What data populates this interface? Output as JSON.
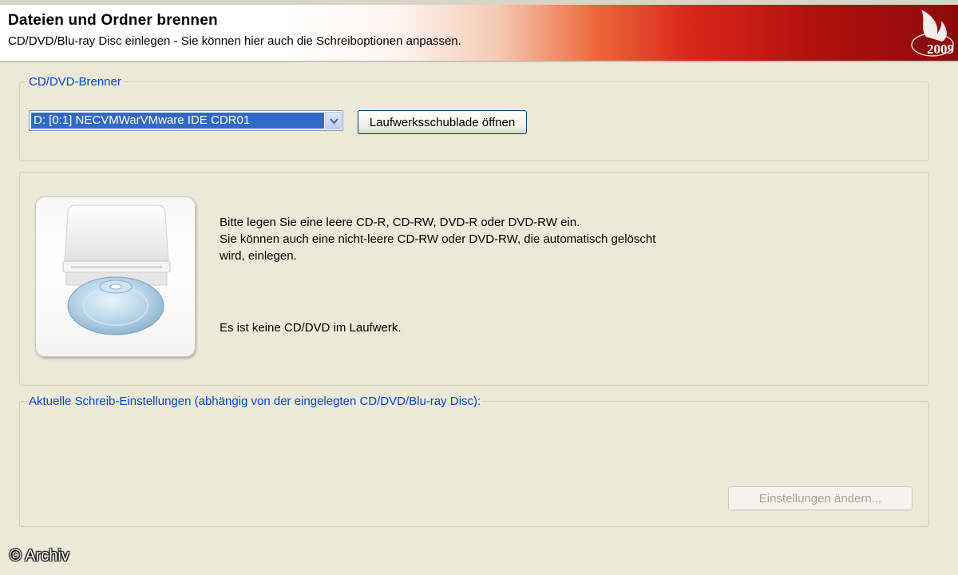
{
  "header": {
    "title": "Dateien und Ordner brennen",
    "subtitle": "CD/DVD/Blu-ray Disc einlegen - Sie können hier auch die Schreiboptionen anpassen.",
    "logo_year": "2009",
    "logo_icon": "flame-icon"
  },
  "burner_group": {
    "legend": "CD/DVD-Brenner",
    "drive_select_value": "D: [0:1] NECVMWarVMware IDE CDR01",
    "eject_button": "Laufwerksschublade öffnen"
  },
  "disc_group": {
    "drive_icon": "cd-drive-icon",
    "instruction_lines": [
      "Bitte legen Sie eine leere CD-R, CD-RW, DVD-R oder DVD-RW ein.",
      "Sie können auch eine nicht-leere CD-RW oder DVD-RW, die automatisch gelöscht",
      "wird, einlegen."
    ],
    "status": "Es ist keine CD/DVD im Laufwerk."
  },
  "settings_group": {
    "legend": "Aktuelle Schreib-Einstellungen (abhängig von der eingelegten CD/DVD/Blu-ray Disc):",
    "change_button": "Einstellungen ändern..."
  },
  "watermark": "© Archiv",
  "colors": {
    "window_bg": "#ece9d8",
    "legend_blue": "#0046d5",
    "selection_blue": "#316ac5",
    "header_red": "#b2100e"
  }
}
